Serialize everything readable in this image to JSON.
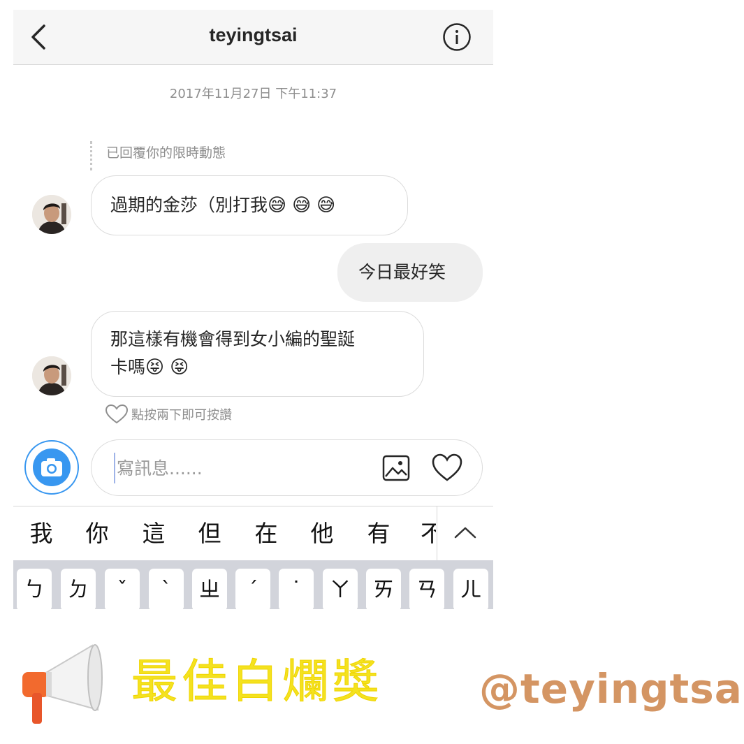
{
  "header": {
    "title": "teyingtsai",
    "back_icon": "chevron-left-icon",
    "info_icon": "info-icon"
  },
  "thread": {
    "timestamp": "2017年11月27日 下午11:37",
    "story_reply_label": "已回覆你的限時動態",
    "messages": [
      {
        "direction": "incoming",
        "text": "過期的金莎（別打我",
        "emoji": [
          "😅",
          "😅",
          "😅"
        ]
      },
      {
        "direction": "outgoing",
        "text": "今日最好笑"
      },
      {
        "direction": "incoming",
        "text_line1": "那這樣有機會得到女小編的聖誕",
        "text_line2": "卡嗎",
        "emoji": [
          "😝",
          "😝"
        ]
      }
    ],
    "like_hint": "點按兩下即可按讚"
  },
  "composer": {
    "placeholder": "寫訊息......",
    "camera_icon": "camera-icon",
    "gallery_icon": "gallery-icon",
    "heart_icon": "heart-icon"
  },
  "keyboard": {
    "suggestions": [
      "我",
      "你",
      "這",
      "但",
      "在",
      "他",
      "有",
      "不"
    ],
    "keys": [
      "ㄅ",
      "ㄉ",
      "ˇ",
      "ˋ",
      "ㄓ",
      "ˊ",
      "˙",
      "ㄚ",
      "ㄞ",
      "ㄢ",
      "ㄦ"
    ]
  },
  "banner": {
    "award": "最佳白爛獎",
    "handle": "@teyingtsai",
    "icon": "megaphone-icon"
  },
  "colors": {
    "accent_blue": "#3897f0",
    "award_yellow": "#f4e21f",
    "handle_tan": "#d49563",
    "outgoing_bubble": "#efefef"
  }
}
